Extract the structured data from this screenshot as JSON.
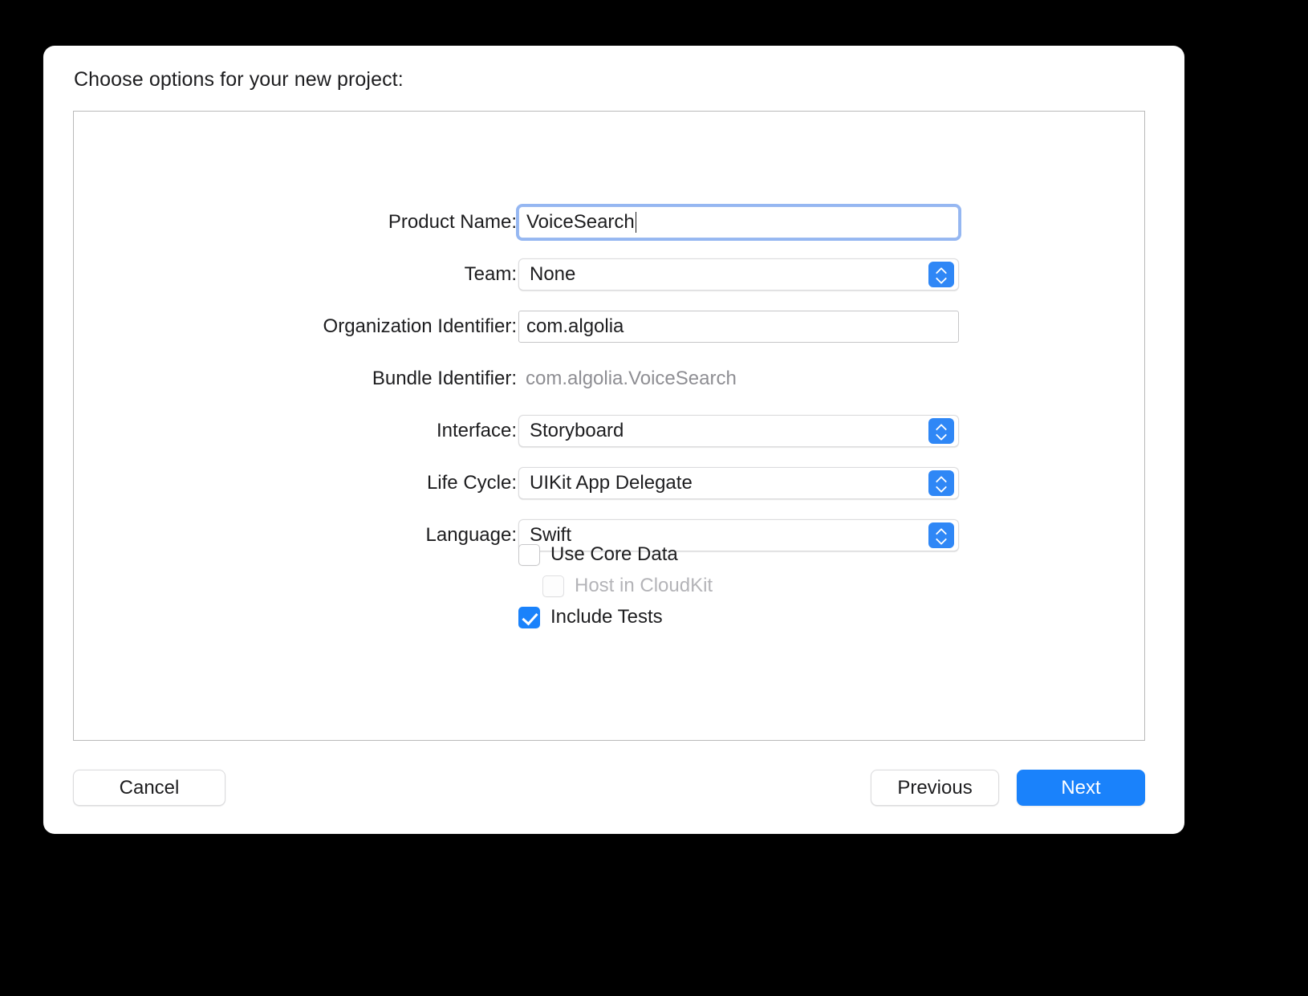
{
  "dialog": {
    "title": "Choose options for your new project:"
  },
  "form": {
    "rows": [
      {
        "label": "Product Name:",
        "type": "text",
        "value": "VoiceSearch",
        "focused": true
      },
      {
        "label": "Team:",
        "type": "popup",
        "value": "None"
      },
      {
        "label": "Organization Identifier:",
        "type": "text",
        "value": "com.algolia",
        "focused": false
      },
      {
        "label": "Bundle Identifier:",
        "type": "static",
        "value": "com.algolia.VoiceSearch"
      },
      {
        "label": "Interface:",
        "type": "popup",
        "value": "Storyboard"
      },
      {
        "label": "Life Cycle:",
        "type": "popup",
        "value": "UIKit App Delegate"
      },
      {
        "label": "Language:",
        "type": "popup",
        "value": "Swift"
      }
    ]
  },
  "checkboxes": [
    {
      "label": "Use Core Data",
      "checked": false,
      "disabled": false,
      "indented": false
    },
    {
      "label": "Host in CloudKit",
      "checked": false,
      "disabled": true,
      "indented": true
    },
    {
      "label": "Include Tests",
      "checked": true,
      "disabled": false,
      "indented": false
    }
  ],
  "footer": {
    "cancel_label": "Cancel",
    "previous_label": "Previous",
    "next_label": "Next"
  },
  "colors": {
    "accent": "#1a82fb",
    "stepper": "#2f87f6",
    "focus_ring": "#5c91eb",
    "disabled_text": "#b4b4b8",
    "static_text": "#8e8e93",
    "backdrop": "#000000"
  },
  "icons": {
    "stepper_up": "chevron-up-icon",
    "stepper_down": "chevron-down-icon",
    "checkmark": "checkmark-icon",
    "caret": "text-caret"
  }
}
